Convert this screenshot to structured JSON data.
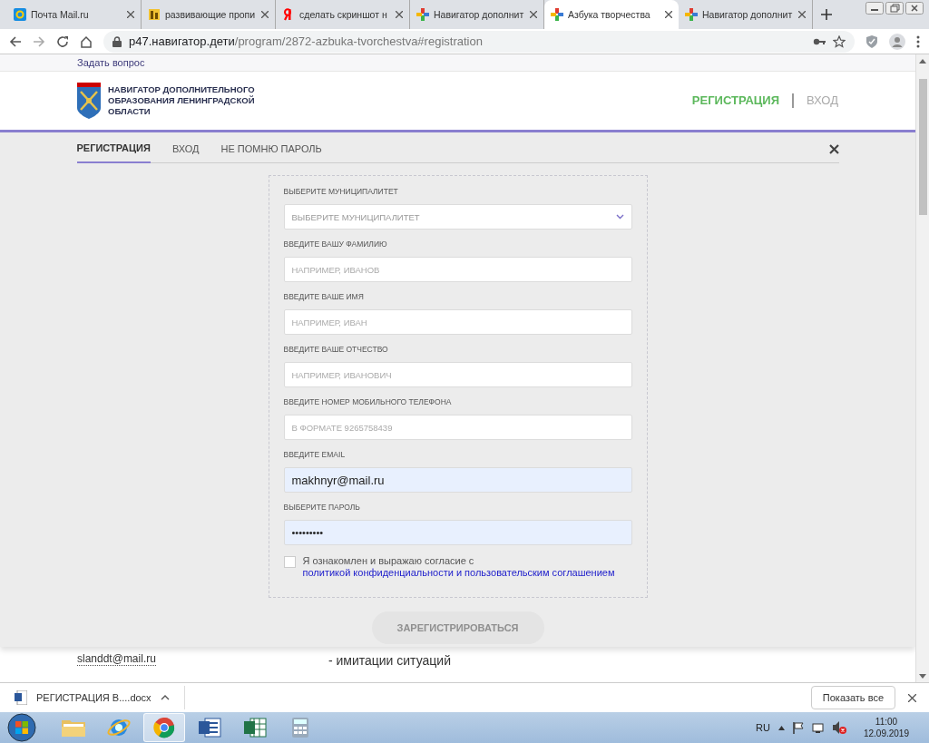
{
  "browser_tabs": [
    {
      "title": "Почта Mail.ru",
      "kind": "mail",
      "selected": false
    },
    {
      "title": "развивающие пропи",
      "kind": "book",
      "selected": false
    },
    {
      "title": "сделать скриншот н",
      "kind": "yandex",
      "selected": false
    },
    {
      "title": "Навигатор дополнит",
      "kind": "navigator",
      "selected": false
    },
    {
      "title": "Азбука творчества",
      "kind": "navigator",
      "selected": true
    },
    {
      "title": "Навигатор дополнит",
      "kind": "navigator",
      "selected": false
    }
  ],
  "address": {
    "host": "p47.навигатор.дети",
    "path": "/program/2872-azbuka-tvorchestva#registration"
  },
  "top_link": "Задать вопрос",
  "site": {
    "title": "НАВИГАТОР ДОПОЛНИТЕЛЬНОГО ОБРАЗОВАНИЯ ЛЕНИНГРАДСКОЙ ОБЛАСТИ",
    "nav": [
      {
        "label": "РЕГИСТРАЦИЯ",
        "selected": true
      },
      {
        "label": "ВХОД",
        "selected": false
      }
    ]
  },
  "modal": {
    "tabs": [
      {
        "label": "РЕГИСТРАЦИЯ",
        "selected": true
      },
      {
        "label": "ВХОД",
        "selected": false
      },
      {
        "label": "НЕ ПОМНЮ ПАРОЛЬ",
        "selected": false
      }
    ],
    "fields": [
      {
        "label": "ВЫБЕРИТЕ МУНИЦИПАЛИТЕТ",
        "kind": "select",
        "placeholder": "ВЫБЕРИТЕ МУНИЦИПАЛИТЕТ"
      },
      {
        "label": "ВВЕДИТЕ ВАШУ ФАМИЛИЮ",
        "kind": "text",
        "placeholder": "НАПРИМЕР, ИВАНОВ"
      },
      {
        "label": "ВВЕДИТЕ ВАШЕ ИМЯ",
        "kind": "text",
        "placeholder": "НАПРИМЕР, ИВАН"
      },
      {
        "label": "ВВЕДИТЕ ВАШЕ ОТЧЕСТВО",
        "kind": "text",
        "placeholder": "НАПРИМЕР, ИВАНОВИЧ"
      },
      {
        "label": "ВВЕДИТЕ НОМЕР МОБИЛЬНОГО ТЕЛЕФОНА",
        "kind": "text",
        "placeholder": "В ФОРМАТЕ 9265758439"
      },
      {
        "label": "ВВЕДИТЕ EMAIL",
        "kind": "text",
        "value": "makhnyr@mail.ru",
        "autofilled": true
      },
      {
        "label": "ВЫБЕРИТЕ ПАРОЛЬ",
        "kind": "password",
        "value": "•••••••••",
        "autofilled": true
      }
    ],
    "consent": {
      "checked": false,
      "text": "Я ознакомлен и выражаю согласие с",
      "link": "политикой конфиденциальности и пользовательским соглашением"
    },
    "submit": {
      "label": "ЗАРЕГИСТРИРОВАТЬСЯ",
      "disabled": true
    }
  },
  "behind": {
    "email": "slanddt@mail.ru",
    "text": "- имитации ситуаций"
  },
  "downloads": {
    "file": "РЕГИСТРАЦИЯ В....docx",
    "show_all": "Показать все"
  },
  "taskbar": {
    "apps": [
      {
        "kind": "folder",
        "selected": false
      },
      {
        "kind": "globe",
        "selected": false
      },
      {
        "kind": "chrome",
        "selected": true
      },
      {
        "kind": "word",
        "selected": false
      },
      {
        "kind": "excel",
        "selected": false
      },
      {
        "kind": "calculator",
        "selected": false
      }
    ],
    "lang": "RU",
    "time": "11:00",
    "date": "12.09.2019"
  }
}
